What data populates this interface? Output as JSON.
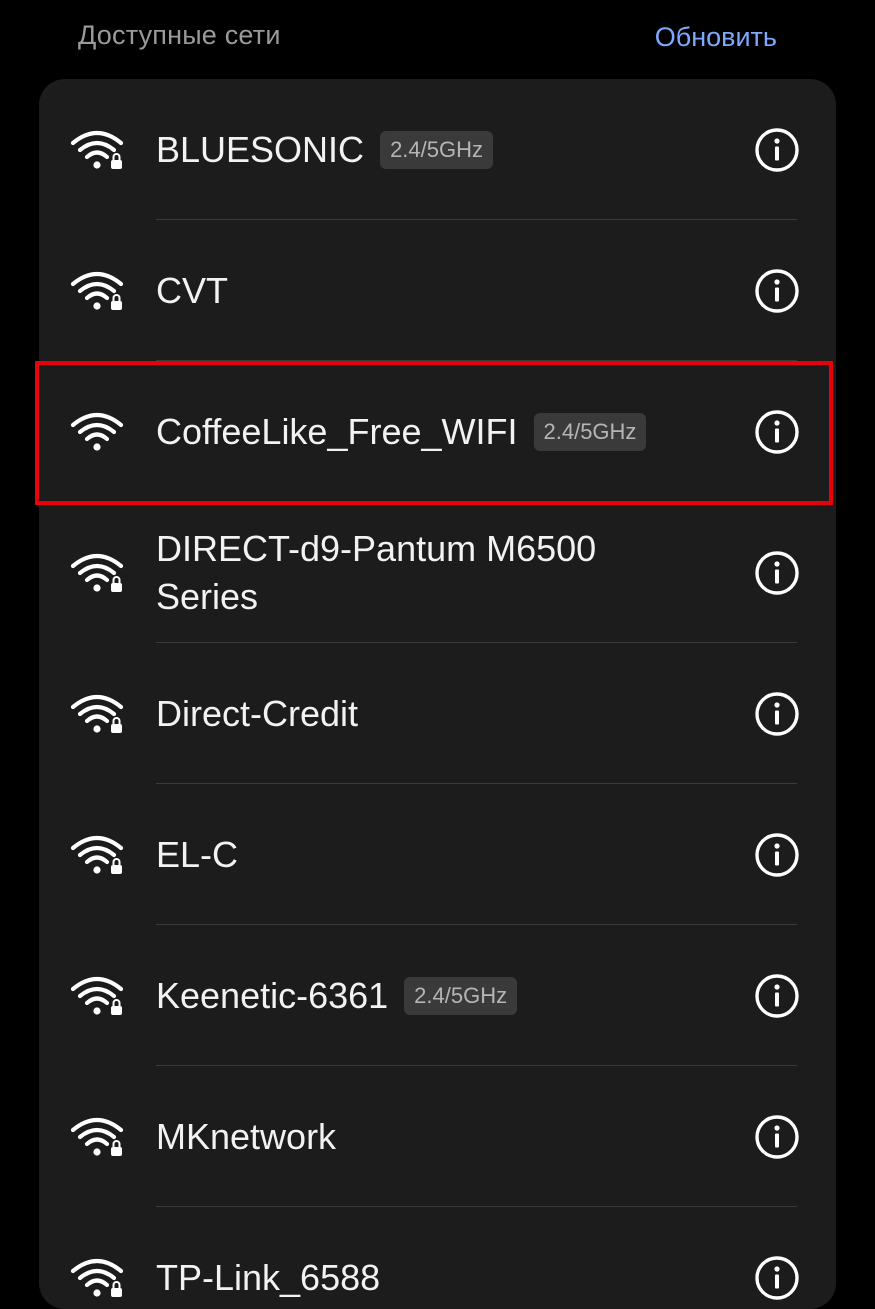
{
  "header": {
    "title": "Доступные сети",
    "refresh_label": "Обновить"
  },
  "colors": {
    "background": "#000000",
    "card": "#1c1c1c",
    "accent": "#7fa8ff",
    "highlight": "#e8000b",
    "badge_bg": "#3a3a3a"
  },
  "networks": [
    {
      "ssid": "BLUESONIC",
      "band": "2.4/5GHz",
      "secured": true,
      "icon": "wifi-lock-icon"
    },
    {
      "ssid": "CVT",
      "band": "",
      "secured": true,
      "icon": "wifi-lock-icon"
    },
    {
      "ssid": "CoffeeLike_Free_WIFI",
      "band": "2.4/5GHz",
      "secured": false,
      "icon": "wifi-icon",
      "highlighted": true
    },
    {
      "ssid": "DIRECT-d9-Pantum M6500 Series",
      "band": "",
      "secured": true,
      "icon": "wifi-lock-icon"
    },
    {
      "ssid": "Direct-Credit",
      "band": "",
      "secured": true,
      "icon": "wifi-lock-icon"
    },
    {
      "ssid": "EL-C",
      "band": "",
      "secured": true,
      "icon": "wifi-lock-icon"
    },
    {
      "ssid": "Keenetic-6361",
      "band": "2.4/5GHz",
      "secured": true,
      "icon": "wifi-lock-icon"
    },
    {
      "ssid": "MKnetwork",
      "band": "",
      "secured": true,
      "icon": "wifi-lock-icon"
    },
    {
      "ssid": "TP-Link_6588",
      "band": "",
      "secured": true,
      "icon": "wifi-lock-icon"
    }
  ]
}
